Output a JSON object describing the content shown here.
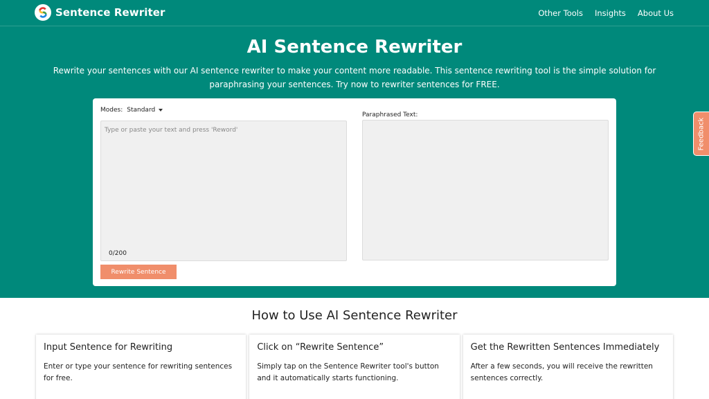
{
  "brand": {
    "name": "Sentence Rewriter",
    "logo_letter": "S"
  },
  "nav": {
    "items": [
      "Other Tools",
      "Insights",
      "About Us"
    ]
  },
  "hero": {
    "title": "AI Sentence Rewriter",
    "subtitle": "Rewrite your sentences with our AI sentence rewriter to make your content more readable. This sentence rewriting tool is the simple solution for paraphrasing your sentences. Try now to rewriter sentences for FREE."
  },
  "tool": {
    "modes_label": "Modes:",
    "mode_selected": "Standard",
    "input_placeholder": "Type or paste your text and press 'Reword'",
    "input_value": "",
    "counter": "0/200",
    "paraphrased_label": "Paraphrased Text:",
    "rewrite_button": "Rewrite Sentence"
  },
  "feedback_label": "Feedback",
  "howto": {
    "title": "How to Use AI Sentence Rewriter",
    "steps": [
      {
        "title": "Input Sentence for Rewriting",
        "text": "Enter or type your sentence for rewriting sentences for free."
      },
      {
        "title": "Click on “Rewrite Sentence”",
        "text": "Simply tap on the Sentence Rewriter tool's button and it automatically starts functioning."
      },
      {
        "title": "Get the Rewritten Sentences Immediately",
        "text": "After a few seconds, you will receive the rewritten sentences correctly."
      }
    ]
  },
  "colors": {
    "primary": "#00897b",
    "accent": "#f08e6b",
    "field_bg": "#f0f0f0"
  }
}
